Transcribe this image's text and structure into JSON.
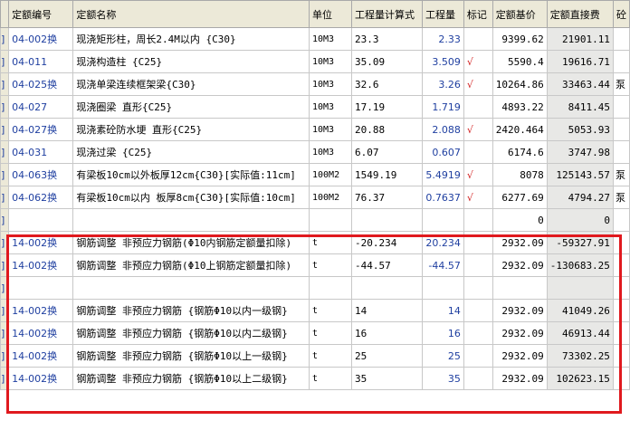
{
  "headers": {
    "code": "定额编号",
    "name": "定额名称",
    "unit": "单位",
    "expr": "工程量计算式",
    "qty": "工程量",
    "mark": "标记",
    "price": "定额基价",
    "total": "定额直接费",
    "extra": "砼"
  },
  "rows": [
    {
      "c0": "]",
      "code": "04-002换",
      "name": "现浇矩形柱，周长2.4M以内 {C30}",
      "unit": "10M3",
      "expr": "23.3",
      "qty": "2.33",
      "mark": "",
      "price": "9399.62",
      "total": "21901.11",
      "extra": ""
    },
    {
      "c0": "]",
      "code": "04-011",
      "name": "现浇构造柱 {C25}",
      "unit": "10M3",
      "expr": "35.09",
      "qty": "3.509",
      "mark": "√",
      "price": "5590.4",
      "total": "19616.71",
      "extra": ""
    },
    {
      "c0": "]",
      "code": "04-025换",
      "name": "现浇单梁连续框架梁{C30}",
      "unit": "10M3",
      "expr": "32.6",
      "qty": "3.26",
      "mark": "√",
      "price": "10264.86",
      "total": "33463.44",
      "extra": "泵"
    },
    {
      "c0": "]",
      "code": "04-027",
      "name": "现浇圈梁 直形{C25}",
      "unit": "10M3",
      "expr": "17.19",
      "qty": "1.719",
      "mark": "",
      "price": "4893.22",
      "total": "8411.45",
      "extra": ""
    },
    {
      "c0": "]",
      "code": "04-027换",
      "name": "现浇素砼防水埂 直形{C25}",
      "unit": "10M3",
      "expr": "20.88",
      "qty": "2.088",
      "mark": "√",
      "price": "2420.464",
      "total": "5053.93",
      "extra": ""
    },
    {
      "c0": "]",
      "code": "04-031",
      "name": "现浇过梁  {C25}",
      "unit": "10M3",
      "expr": "6.07",
      "qty": "0.607",
      "mark": "",
      "price": "6174.6",
      "total": "3747.98",
      "extra": ""
    },
    {
      "c0": "]",
      "code": "04-063换",
      "name": "有梁板10cm以外板厚12cm{C30}[实际值:11cm]",
      "unit": "100M2",
      "expr": "1549.19",
      "qty": "5.4919",
      "mark": "√",
      "price": "8078",
      "total": "125143.57",
      "extra": "泵"
    },
    {
      "c0": "]",
      "code": "04-062换",
      "name": "有梁板10cm以内 板厚8cm{C30}[实际值:10cm]",
      "unit": "100M2",
      "expr": "76.37",
      "qty": "0.7637",
      "mark": "√",
      "price": "6277.69",
      "total": "4794.27",
      "extra": "泵"
    },
    {
      "c0": "]",
      "code": "",
      "name": "",
      "unit": "",
      "expr": "",
      "qty": "",
      "mark": "",
      "price": "0",
      "total": "0",
      "extra": ""
    },
    {
      "c0": "]",
      "code": "14-002换",
      "name": "钢筋调整 非预应力钢筋(Φ10内钢筋定额量扣除)",
      "unit": "t",
      "expr": "-20.234",
      "qty": "20.234",
      "mark": "",
      "price": "2932.09",
      "total": "-59327.91",
      "extra": ""
    },
    {
      "c0": "]",
      "code": "14-002换",
      "name": "钢筋调整 非预应力钢筋(Φ10上钢筋定额量扣除)",
      "unit": "t",
      "expr": "-44.57",
      "qty": "-44.57",
      "mark": "",
      "price": "2932.09",
      "total": "-130683.25",
      "extra": ""
    },
    {
      "c0": "]",
      "code": "",
      "name": "",
      "unit": "",
      "expr": "",
      "qty": "",
      "mark": "",
      "price": "",
      "total": "",
      "extra": ""
    },
    {
      "c0": "]",
      "code": "14-002换",
      "name": "钢筋调整 非预应力钢筋 {钢筋Φ10以内一级钢}",
      "unit": "t",
      "expr": "14",
      "qty": "14",
      "mark": "",
      "price": "2932.09",
      "total": "41049.26",
      "extra": ""
    },
    {
      "c0": "]",
      "code": "14-002换",
      "name": "钢筋调整 非预应力钢筋 {钢筋Φ10以内二级钢}",
      "unit": "t",
      "expr": "16",
      "qty": "16",
      "mark": "",
      "price": "2932.09",
      "total": "46913.44",
      "extra": ""
    },
    {
      "c0": "]",
      "code": "14-002换",
      "name": "钢筋调整 非预应力钢筋 {钢筋Φ10以上一级钢}",
      "unit": "t",
      "expr": "25",
      "qty": "25",
      "mark": "",
      "price": "2932.09",
      "total": "73302.25",
      "extra": ""
    },
    {
      "c0": "]",
      "code": "14-002换",
      "name": "钢筋调整 非预应力钢筋 {钢筋Φ10以上二级钢}",
      "unit": "t",
      "expr": "35",
      "qty": "35",
      "mark": "",
      "price": "2932.09",
      "total": "102623.15",
      "extra": ""
    }
  ],
  "colors": {
    "highlight": "#e0191e",
    "qty": "#1f3fa0",
    "mark": "#d21e1e",
    "total_bg": "#e8e8e6"
  }
}
